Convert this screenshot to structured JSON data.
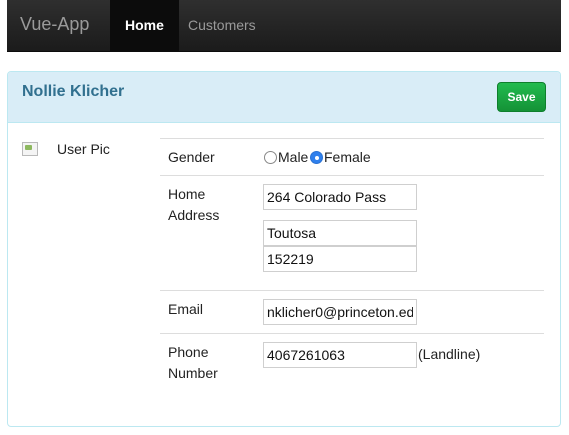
{
  "navbar": {
    "brand": "Vue-App",
    "items": [
      {
        "label": "Home",
        "active": true
      },
      {
        "label": "Customers",
        "active": false
      }
    ]
  },
  "panel": {
    "title": "Nollie Klicher",
    "save_label": "Save"
  },
  "profile": {
    "pic_label": "User Pic",
    "gender": {
      "label": "Gender",
      "options": [
        "Male",
        "Female"
      ],
      "selected": "Female"
    },
    "address": {
      "label_line1": "Home",
      "label_line2": "Address",
      "street": "264 Colorado Pass",
      "city": "Toutosa",
      "zip": "152219"
    },
    "email": {
      "label": "Email",
      "value": "nklicher0@princeton.ed"
    },
    "phone": {
      "label_line1": "Phone",
      "label_line2": "Number",
      "value": "4067261063",
      "type": "(Landline)"
    }
  },
  "colors": {
    "navbar_bg": "#222222",
    "panel_heading_bg": "#d9edf7",
    "panel_title": "#31708f",
    "save_button": "#1da843",
    "radio_selected": "#2f80ed"
  }
}
